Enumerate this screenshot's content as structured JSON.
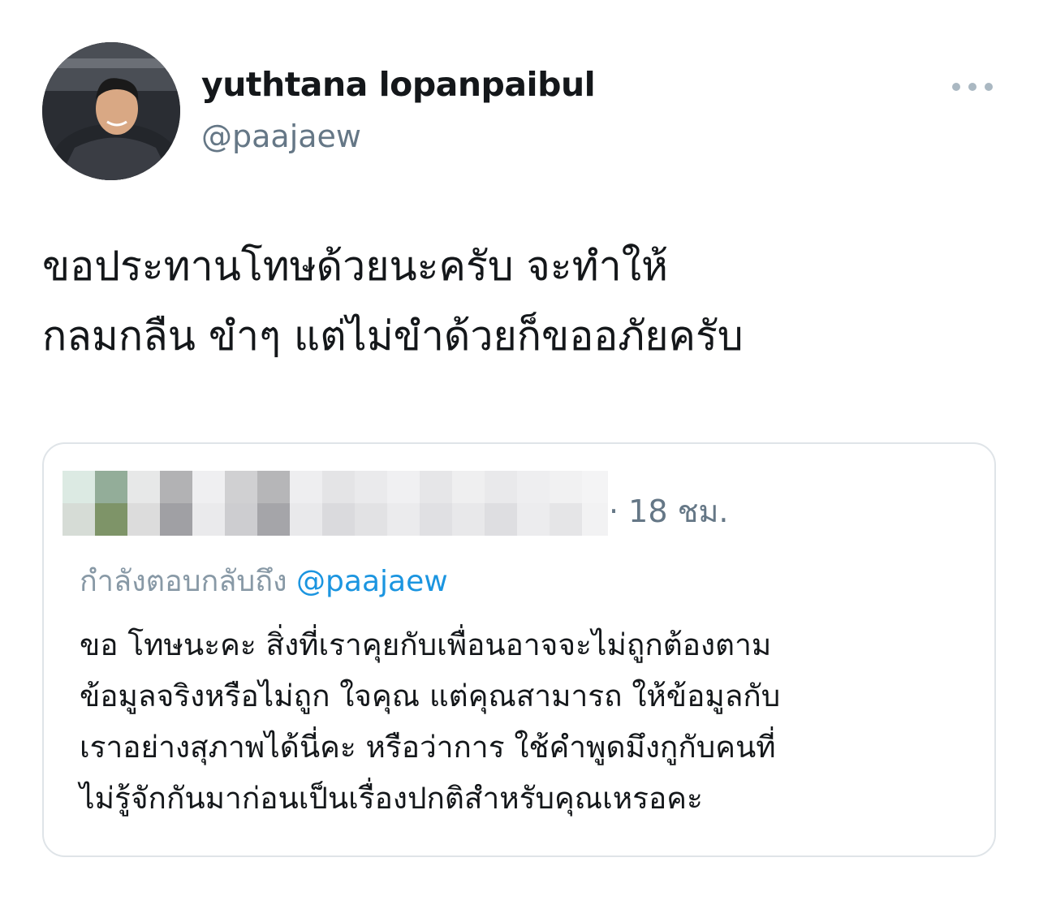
{
  "author": {
    "display_name": "yuthtana lopanpaibul",
    "handle": "@paajaew"
  },
  "more_icon": "more-horizontal-icon",
  "tweet": {
    "lines": [
      "ขอประทานโทษด้วยนะครับ  จะทำให้",
      "กลมกลืน ขำๆ  แต่ไม่ขำด้วยก็ขออภัยครับ"
    ]
  },
  "quoted_tweet": {
    "timestamp": "· 18 ชม.",
    "replying_to_label": "กำลังตอบกลับถึง",
    "replying_to_handle": "@paajaew",
    "lines": [
      "ขอ โทษนะคะ สิ่งที่เราคุยกับเพื่อนอาจจะไม่ถูกต้องตาม",
      "ข้อมูลจริงหรือไม่ถูก ใจคุณ แต่คุณสามารถ ให้ข้อมูลกับ",
      "เราอย่างสุภาพได้นี่คะ หรือว่าการ ใช้คำพูดมึงกูกับคนที่",
      "ไม่รู้จักกันมาก่อนเป็นเรื่องปกติสำหรับคุณเหรอคะ"
    ]
  },
  "colors": {
    "text_primary": "#14171a",
    "text_secondary": "#657786",
    "mention": "#1b95e0",
    "border": "#dfe4e8"
  }
}
